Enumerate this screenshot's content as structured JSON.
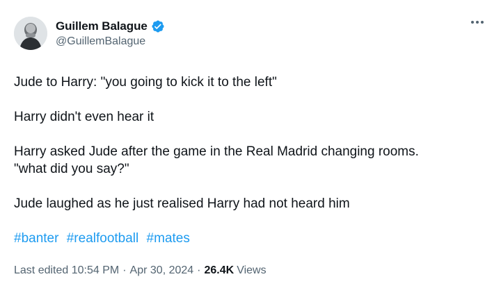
{
  "author": {
    "name": "Guillem Balague",
    "handle": "@GuillemBalague",
    "verified": true,
    "accent_color": "#1d9bf0"
  },
  "tweet": {
    "paragraphs": [
      "Jude to Harry: \"you going to kick it to the left\"",
      "Harry didn't even hear it",
      "Harry asked Jude after the game in the Real Madrid changing rooms.",
      "\"what did you say?\"",
      "Jude laughed as he just realised Harry had not heard him"
    ],
    "hashtags": [
      "#banter",
      "#realfootball",
      "#mates"
    ]
  },
  "meta": {
    "edited_label": "Last edited",
    "time": "10:54 PM",
    "separator": "·",
    "date": "Apr 30, 2024",
    "views_count": "26.4K",
    "views_label": "Views"
  },
  "icons": {
    "more": "more-horizontal-icon",
    "verified": "verified-badge-icon"
  }
}
